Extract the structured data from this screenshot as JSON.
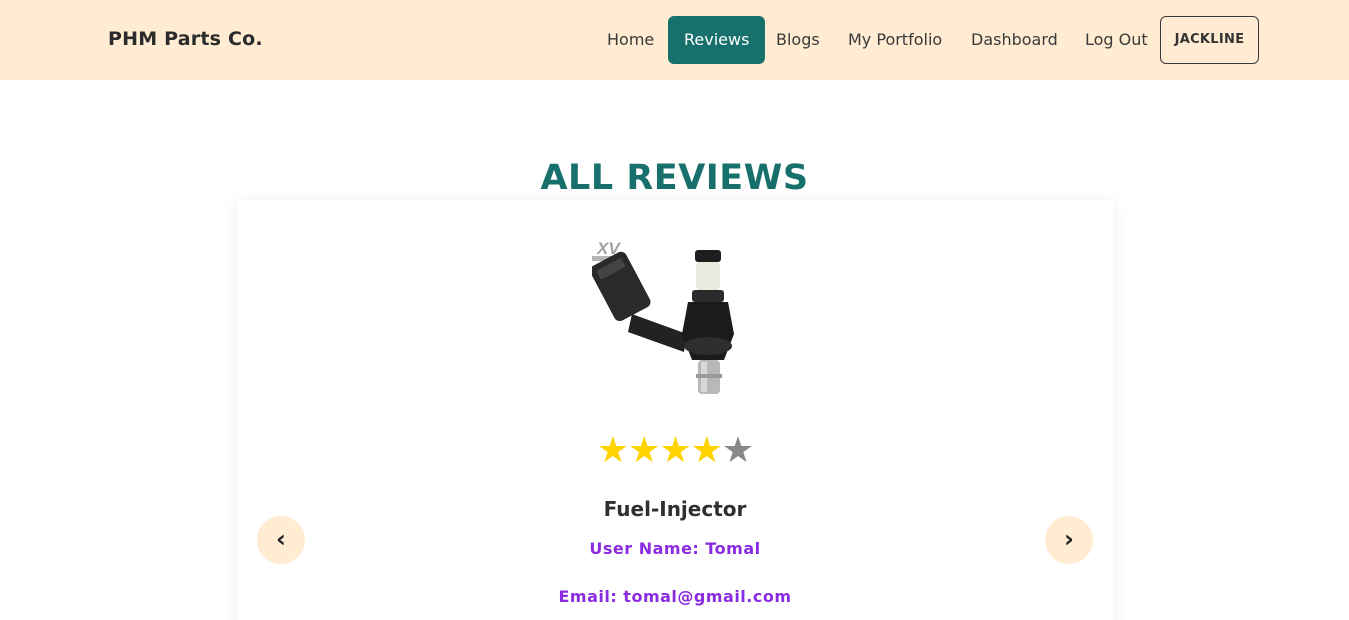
{
  "nav": {
    "brand": "PHM Parts Co.",
    "links": [
      {
        "label": "Home"
      },
      {
        "label": "Reviews",
        "active": true
      },
      {
        "label": "Blogs"
      },
      {
        "label": "My Portfolio"
      },
      {
        "label": "Dashboard"
      },
      {
        "label": "Log Out"
      }
    ],
    "user_button": "JACKLINE"
  },
  "reviews": {
    "title": "ALL REVIEWS",
    "current": {
      "product_name": "Fuel-Injector",
      "rating": 4,
      "max_rating": 5,
      "user_name_line": "User Name: Tomal",
      "email_line": "Email: tomal@gmail.com"
    },
    "prev_icon": "‹",
    "next_icon": "›"
  },
  "colors": {
    "nav_bg": "#ffecd2",
    "accent": "#17706b",
    "star_filled": "#ffd200",
    "star_empty": "#888888",
    "user_text": "#8a2be2"
  }
}
